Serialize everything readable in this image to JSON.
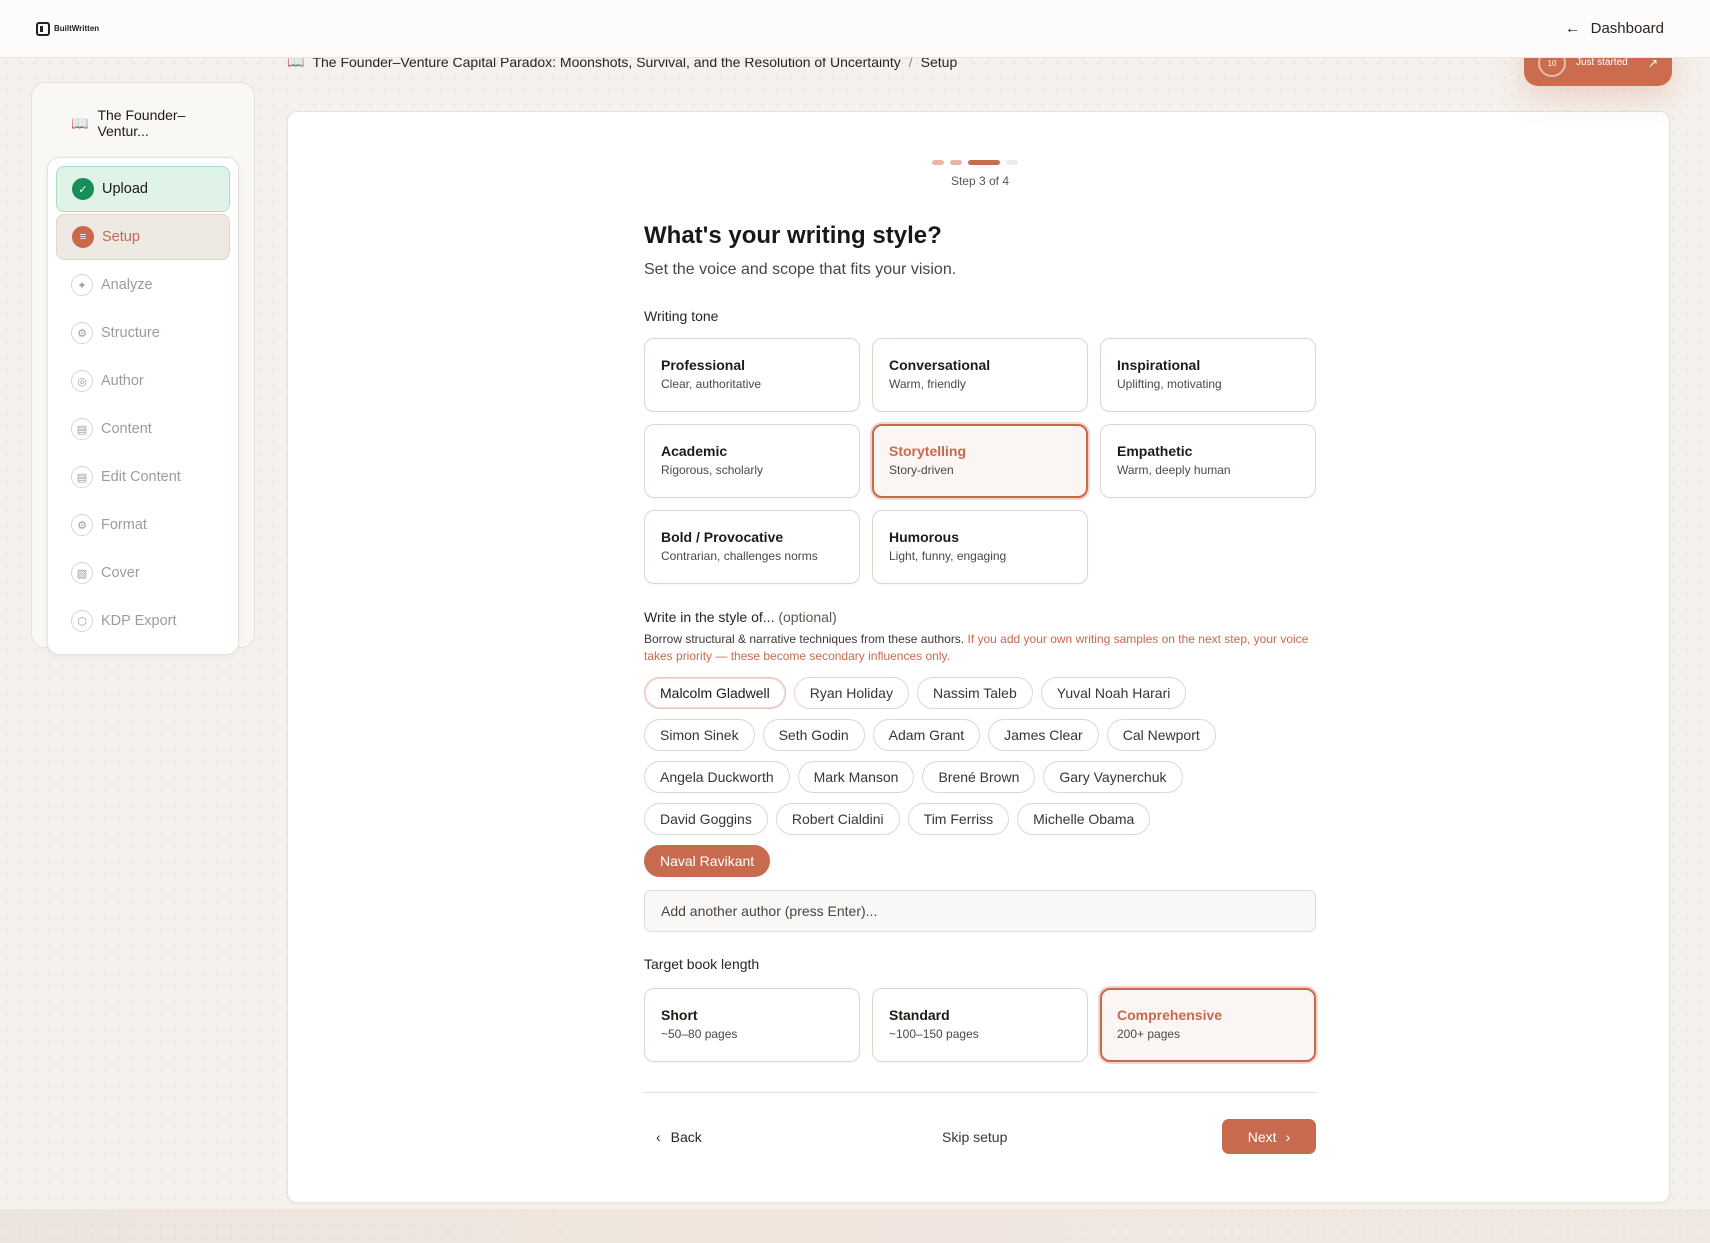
{
  "topbar": {
    "logo_text": "BuiltWritten",
    "dashboard_label": "Dashboard",
    "progress_ring": "10",
    "progress_status": "Just started"
  },
  "breadcrumb": {
    "book_title": "The Founder–Venture Capital Paradox: Moonshots, Survival, and the Resolution of Uncertainty",
    "separator": "/",
    "current": "Setup"
  },
  "sidebar": {
    "project_title": "The Founder–Ventur...",
    "steps": [
      {
        "label": "Upload",
        "state": "done",
        "icon": "check-circle-icon"
      },
      {
        "label": "Setup",
        "state": "active",
        "icon": "sliders-icon"
      },
      {
        "label": "Analyze",
        "state": "pending",
        "icon": "wand-icon"
      },
      {
        "label": "Structure",
        "state": "pending",
        "icon": "gear-icon"
      },
      {
        "label": "Author",
        "state": "pending",
        "icon": "user-icon"
      },
      {
        "label": "Content",
        "state": "pending",
        "icon": "file-pen-icon"
      },
      {
        "label": "Edit Content",
        "state": "pending",
        "icon": "file-pen-icon"
      },
      {
        "label": "Format",
        "state": "pending",
        "icon": "gear-icon"
      },
      {
        "label": "Cover",
        "state": "pending",
        "icon": "image-icon"
      },
      {
        "label": "KDP Export",
        "state": "pending",
        "icon": "package-icon"
      }
    ]
  },
  "wizard": {
    "step_text": "Step 3 of 4",
    "title": "What's your writing style?",
    "subtitle": "Set the voice and scope that fits your vision.",
    "tone_label": "Writing tone",
    "tones": [
      {
        "title": "Professional",
        "sub": "Clear, authoritative"
      },
      {
        "title": "Conversational",
        "sub": "Warm, friendly"
      },
      {
        "title": "Inspirational",
        "sub": "Uplifting, motivating"
      },
      {
        "title": "Academic",
        "sub": "Rigorous, scholarly"
      },
      {
        "title": "Storytelling",
        "sub": "Story-driven",
        "selected": true
      },
      {
        "title": "Empathetic",
        "sub": "Warm, deeply human"
      },
      {
        "title": "Bold / Provocative",
        "sub": "Contrarian, challenges norms"
      },
      {
        "title": "Humorous",
        "sub": "Light, funny, engaging"
      }
    ],
    "style_label": "Write in the style of...",
    "style_optional": "(optional)",
    "style_desc": "Borrow structural & narrative techniques from these authors.",
    "style_desc_accent": "If you add your own writing samples on the next step, your voice takes priority — these become secondary influences only.",
    "authors": [
      [
        "Malcolm Gladwell",
        "Ryan Holiday",
        "Nassim Taleb",
        "Yuval Noah Harari"
      ],
      [
        "Simon Sinek",
        "Seth Godin",
        "Adam Grant",
        "James Clear",
        "Cal Newport"
      ],
      [
        "Angela Duckworth",
        "Mark Manson",
        "Brené Brown",
        "Gary Vaynerchuk"
      ],
      [
        "David Goggins",
        "Robert Cialdini",
        "Tim Ferriss",
        "Michelle Obama"
      ],
      [
        "Naval Ravikant"
      ]
    ],
    "selected_author": "Naval Ravikant",
    "soft_author": "Malcolm Gladwell",
    "author_placeholder": "Add another author (press Enter)...",
    "length_label": "Target book length",
    "lengths": [
      {
        "title": "Short",
        "sub": "~50–80 pages"
      },
      {
        "title": "Standard",
        "sub": "~100–150 pages"
      },
      {
        "title": "Comprehensive",
        "sub": "200+ pages",
        "selected": true
      }
    ],
    "back_label": "Back",
    "skip_label": "Skip setup",
    "next_label": "Next"
  },
  "colors": {
    "accent": "#c86a4e",
    "success": "#178d57",
    "background": "#f5f1ec"
  }
}
